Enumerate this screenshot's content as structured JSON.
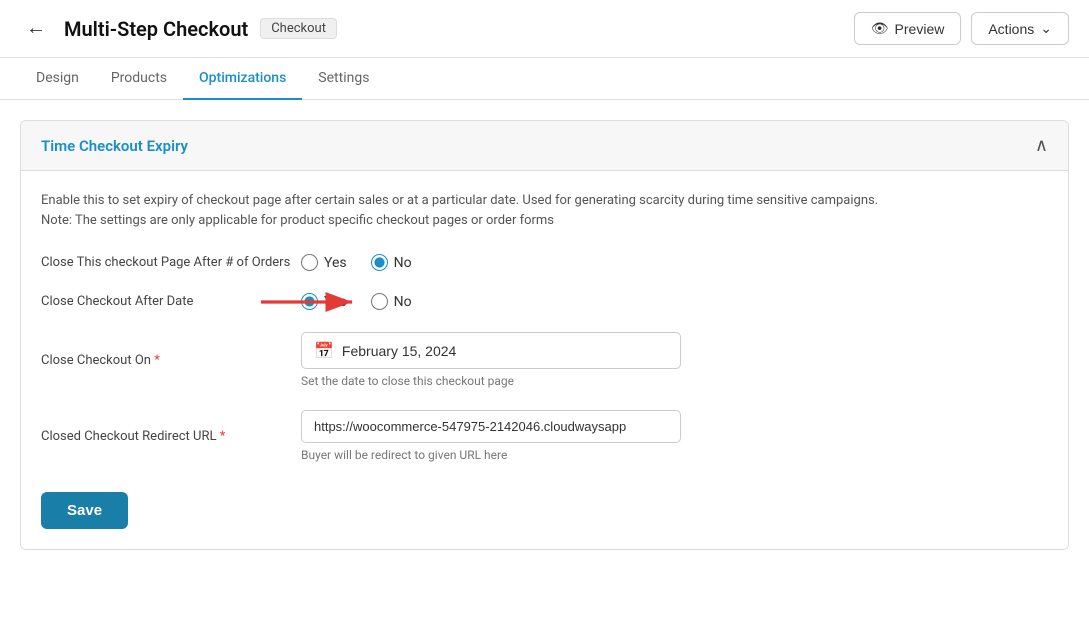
{
  "header": {
    "back_label": "←",
    "title": "Multi-Step Checkout",
    "badge": "Checkout",
    "preview_label": "Preview",
    "actions_label": "Actions",
    "preview_icon": "👁"
  },
  "tabs": [
    {
      "id": "design",
      "label": "Design",
      "active": false
    },
    {
      "id": "products",
      "label": "Products",
      "active": false
    },
    {
      "id": "optimizations",
      "label": "Optimizations",
      "active": true
    },
    {
      "id": "settings",
      "label": "Settings",
      "active": false
    }
  ],
  "section": {
    "title_prefix": "Time Checkout ",
    "title_highlight": "Expiry",
    "description_line1": "Enable this to set expiry of checkout page after certain sales or at a particular date. Used for generating scarcity during time sensitive campaigns.",
    "description_line2": "Note: The settings are only applicable for product specific checkout pages or order forms",
    "collapse_icon": "∧"
  },
  "form": {
    "close_orders_label": "Close This checkout Page After # of Orders",
    "close_orders_yes": "Yes",
    "close_orders_no": "No",
    "close_orders_selected": "no",
    "close_date_label": "Close Checkout After Date",
    "close_date_yes": "Yes",
    "close_date_no": "No",
    "close_date_selected": "yes",
    "close_on_label": "Close Checkout On",
    "close_on_required": "*",
    "close_on_date": "February 15, 2024",
    "close_on_hint": "Set the date to close this checkout page",
    "redirect_label": "Closed Checkout Redirect URL",
    "redirect_required": "*",
    "redirect_value": "https://woocommerce-547975-2142046.cloudwaysapp",
    "redirect_hint": "Buyer will be redirect to given URL here",
    "save_label": "Save"
  }
}
